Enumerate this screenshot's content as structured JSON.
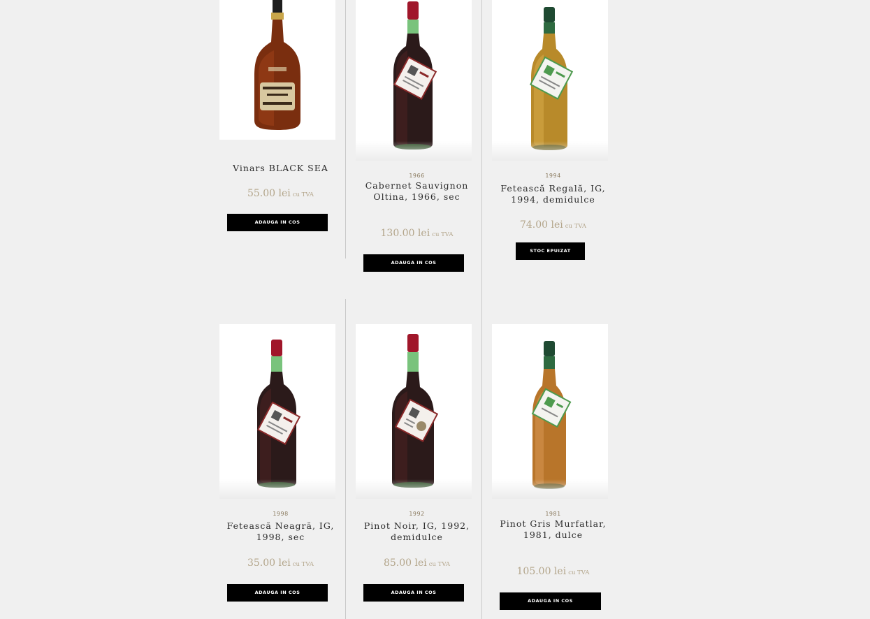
{
  "products": [
    {
      "name": "Vinars BLACK SEA",
      "year": "",
      "price": "55.00 lei",
      "vat": "cu TVA",
      "button": "ADAUGA IN COS",
      "bottle": "brandy",
      "colors": {
        "glass": "#7a2e0f",
        "cap": "#1e1e1e",
        "label": "#d8c8a0"
      }
    },
    {
      "name": "Cabernet Sauvignon Oltina, 1966, sec",
      "year": "1966",
      "price": "130.00 lei",
      "vat": "cu TVA",
      "button": "ADAUGA IN COS",
      "bottle": "red-wine",
      "colors": {
        "glass": "#2b1a1a",
        "cap": "#a0162a",
        "tag": "#8b2a2a"
      }
    },
    {
      "name": "Fetească Regală, IG, 1994, demidulce",
      "year": "1994",
      "price": "74.00 lei",
      "vat": "cu TVA",
      "button": "STOC EPUIZAT",
      "bottle": "white-wine",
      "colors": {
        "glass": "#b88a2a",
        "cap": "#1f4a32",
        "tag": "#4e9a4e"
      }
    },
    {
      "name": "Fetească Neagră, IG, 1998, sec",
      "year": "1998",
      "price": "35.00 lei",
      "vat": "cu TVA",
      "button": "ADAUGA IN COS",
      "bottle": "red-wine",
      "colors": {
        "glass": "#2b1a1a",
        "cap": "#a0162a",
        "tag": "#8b2a2a"
      }
    },
    {
      "name": "Pinot Noir, IG, 1992, demidulce",
      "year": "1992",
      "price": "85.00 lei",
      "vat": "cu TVA",
      "button": "ADAUGA IN COS",
      "bottle": "red-wine",
      "colors": {
        "glass": "#2b1a1a",
        "cap": "#a0162a",
        "tag": "#8b2a2a"
      }
    },
    {
      "name": "Pinot Gris Murfatlar, 1981, dulce",
      "year": "1981",
      "price": "105.00 lei",
      "vat": "cu TVA",
      "button": "ADAUGA IN COS",
      "bottle": "white-wine",
      "colors": {
        "glass": "#b8752a",
        "cap": "#1f4a32",
        "tag": "#4e9a4e"
      }
    }
  ]
}
